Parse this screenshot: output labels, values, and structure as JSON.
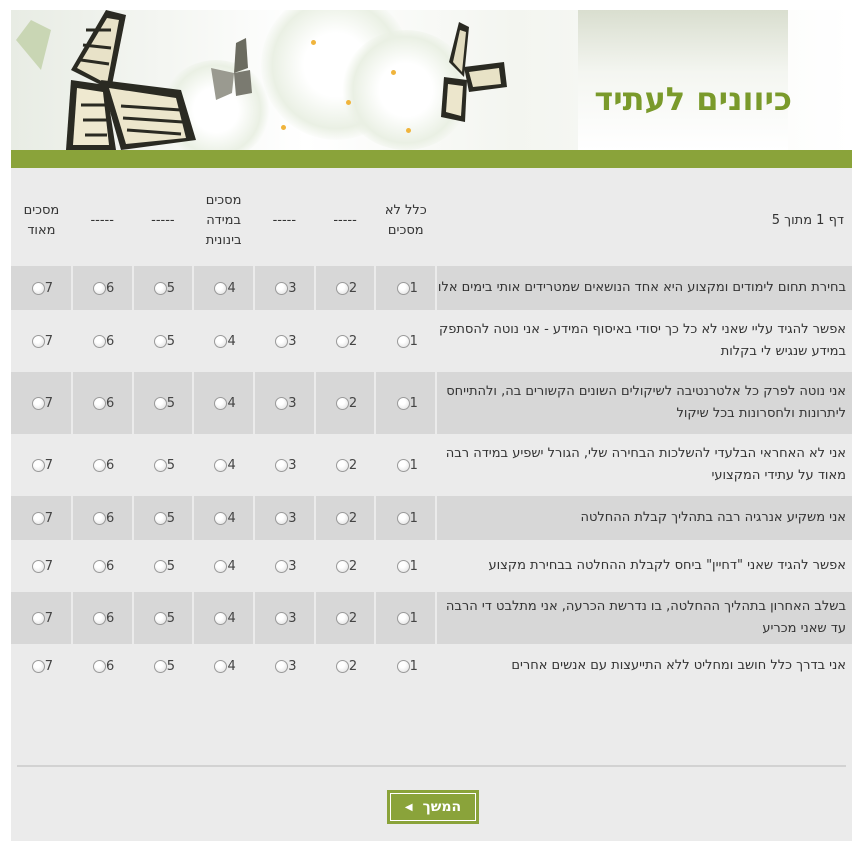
{
  "header": {
    "title": "כיוונים לעתיד"
  },
  "scale": {
    "page_info": "דף 1 מתוך 5",
    "col1": "כלל לא\nמסכים",
    "col2": "-----",
    "col3": "-----",
    "col4": "מסכים\nבמידה\nבינונית",
    "col5": "-----",
    "col6": "-----",
    "col7": "מסכים\nמאוד"
  },
  "options": [
    "1",
    "2",
    "3",
    "4",
    "5",
    "6",
    "7"
  ],
  "rows": [
    "בחירת תחום לימודים ומקצוע היא אחד הנושאים שמטרידים אותי בימים אלו",
    "אפשר להגיד עליי שאני לא כל כך יסודי באיסוף המידע - אני נוטה להסתפק במידע שנגיש לי בקלות",
    "אני נוטה לפרק כל אלטרנטיבה לשיקולים השונים הקשורים בה, ולהתייחס ליתרונות ולחסרונות בכל שיקול",
    "אני לא האחראי הבלעדי להשלכות הבחירה שלי, הגורל ישפיע במידה רבה מאוד על עתידי המקצועי",
    "אני משקיע אנרגיה רבה בתהליך קבלת ההחלטה",
    "אפשר להגיד שאני \"דחיין\" ביחס לקבלת ההחלטה בבחירת מקצוע",
    "בשלב האחרון בתהליך ההחלטה, בו נדרשת הכרעה, אני מתלבט די הרבה עד שאני מכריע",
    "אני בדרך כלל חושב ומחליט ללא התייעצות עם אנשים אחרים"
  ],
  "button": {
    "next_label": "המשך"
  },
  "colors": {
    "accent_green": "#8aa33a",
    "title_green": "#7a9a2b",
    "row_shade": "#d7d7d7",
    "background": "#ebebeb"
  },
  "icons": {
    "next_arrow": "triangle-left-icon",
    "butterflies": "butterfly-icon"
  }
}
